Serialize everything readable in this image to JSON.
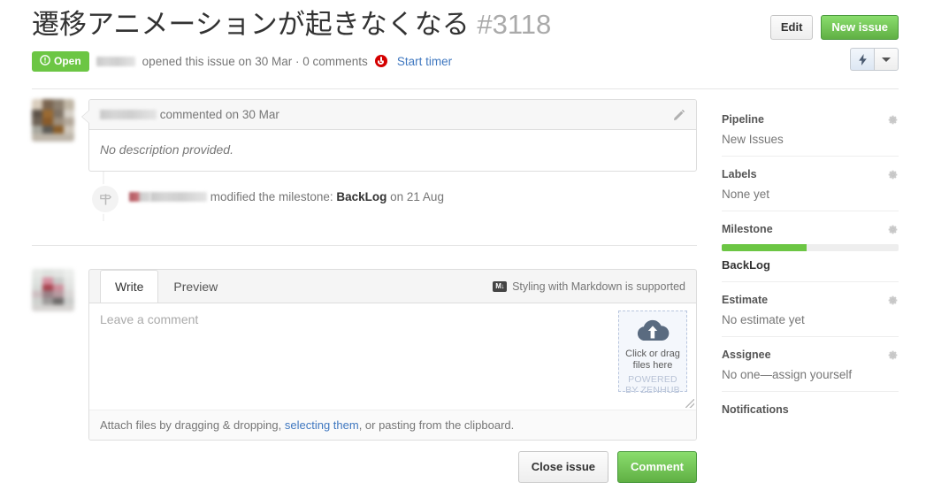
{
  "header": {
    "title": "遷移アニメーションが起きなくなる",
    "number": "#3118",
    "edit_label": "Edit",
    "new_issue_label": "New issue",
    "state_label": "Open",
    "meta_opened": "opened this issue on 30 Mar · 0 comments",
    "start_timer_label": "Start timer"
  },
  "comment": {
    "author_action": "commented on 30 Mar",
    "body": "No description provided."
  },
  "event": {
    "text_before": "modified the milestone:",
    "milestone": "BackLog",
    "text_after": "on 21 Aug"
  },
  "form": {
    "tab_write": "Write",
    "tab_preview": "Preview",
    "markdown_note": "Styling with Markdown is supported",
    "markdown_icon_glyph": "M↓",
    "placeholder": "Leave a comment",
    "dropzone_line1": "Click or drag",
    "dropzone_line2": "files here",
    "dropzone_powered1": "POWERED",
    "dropzone_powered2": "BY ZENHUB",
    "attach_prefix": "Attach files by dragging & dropping, ",
    "attach_link": "selecting them",
    "attach_suffix": ", or pasting from the clipboard.",
    "close_issue_label": "Close issue",
    "comment_label": "Comment"
  },
  "sidebar": {
    "sections": [
      {
        "title": "Pipeline",
        "value": "New Issues"
      },
      {
        "title": "Labels",
        "value": "None yet"
      },
      {
        "title": "Milestone",
        "value": "BackLog",
        "progress": 48
      },
      {
        "title": "Estimate",
        "value": "No estimate yet"
      },
      {
        "title": "Assignee",
        "value": "No one—assign yourself"
      },
      {
        "title": "Notifications",
        "value": ""
      }
    ]
  },
  "colors": {
    "green": "#6cc644",
    "link": "#4078c0",
    "red": "#d40000"
  }
}
